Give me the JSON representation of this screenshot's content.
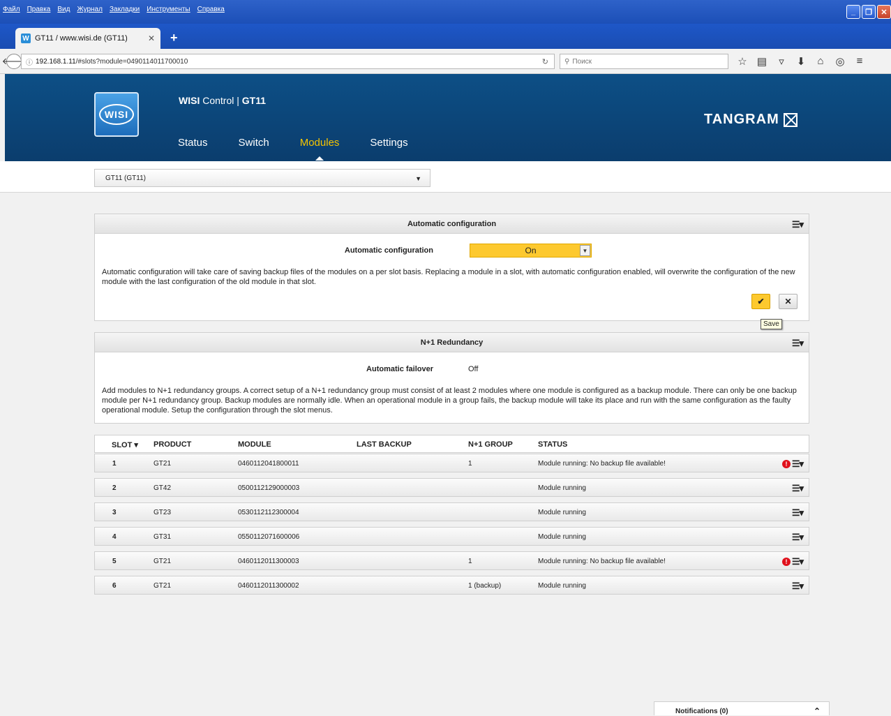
{
  "browser": {
    "menu": [
      "Файл",
      "Правка",
      "Вид",
      "Журнал",
      "Закладки",
      "Инструменты",
      "Справка"
    ],
    "tab_title": "GT11 / www.wisi.de (GT11)",
    "tab_favicon": "W",
    "url_host": "192.168.1.11",
    "url_path": "/#slots?module=0490114011700010",
    "search_placeholder": "Поиск"
  },
  "header": {
    "logo_text": "WISI",
    "app_name": "WISI",
    "app_control": " Control | ",
    "device": "GT11",
    "brand": "TANGRAM",
    "nav": [
      "Status",
      "Switch",
      "Modules",
      "Settings"
    ],
    "active_nav": "Modules"
  },
  "device_select": {
    "value": "GT11 (GT11)"
  },
  "auto_config": {
    "title": "Automatic configuration",
    "field_label": "Automatic configuration",
    "value": "On",
    "description": "Automatic configuration will take care of saving backup files of the modules on a per slot basis. Replacing a module in a slot, with automatic configuration enabled, will overwrite the configuration of the new module with the last configuration of the old module in that slot.",
    "save_tooltip": "Save"
  },
  "redundancy": {
    "title": "N+1 Redundancy",
    "field_label": "Automatic failover",
    "value": "Off",
    "description": "Add modules to N+1 redundancy groups. A correct setup of a N+1 redundancy group must consist of at least 2 modules where one module is configured as a backup module. There can only be one backup module per N+1 redundancy group. Backup modules are normally idle. When an operational module in a group fails, the backup module will take its place and run with the same configuration as the faulty operational module. Setup the configuration through the slot menus."
  },
  "slots": {
    "headers": {
      "slot": "SLOT ▾",
      "product": "PRODUCT",
      "module": "MODULE",
      "last_backup": "LAST BACKUP",
      "group": "N+1 GROUP",
      "status": "STATUS"
    },
    "rows": [
      {
        "slot": "1",
        "product": "GT21",
        "module": "0460112041800011",
        "last_backup": "",
        "group": "1",
        "status": "Module running: No backup file available!"
      },
      {
        "slot": "2",
        "product": "GT42",
        "module": "0500112129000003",
        "last_backup": "",
        "group": "",
        "status": "Module running"
      },
      {
        "slot": "3",
        "product": "GT23",
        "module": "0530112112300004",
        "last_backup": "",
        "group": "",
        "status": "Module running"
      },
      {
        "slot": "4",
        "product": "GT31",
        "module": "0550112071600006",
        "last_backup": "",
        "group": "",
        "status": "Module running"
      },
      {
        "slot": "5",
        "product": "GT21",
        "module": "0460112011300003",
        "last_backup": "",
        "group": "1",
        "status": "Module running: No backup file available!"
      },
      {
        "slot": "6",
        "product": "GT21",
        "module": "0460112011300002",
        "last_backup": "",
        "group": "1 (backup)",
        "status": "Module running"
      }
    ]
  },
  "notifications": {
    "label": "Notifications (0)"
  },
  "colors": {
    "header_bg": "#0b3d6d",
    "accent": "#fdc92f",
    "active_nav": "#f5c400",
    "warning": "#e0111c"
  }
}
